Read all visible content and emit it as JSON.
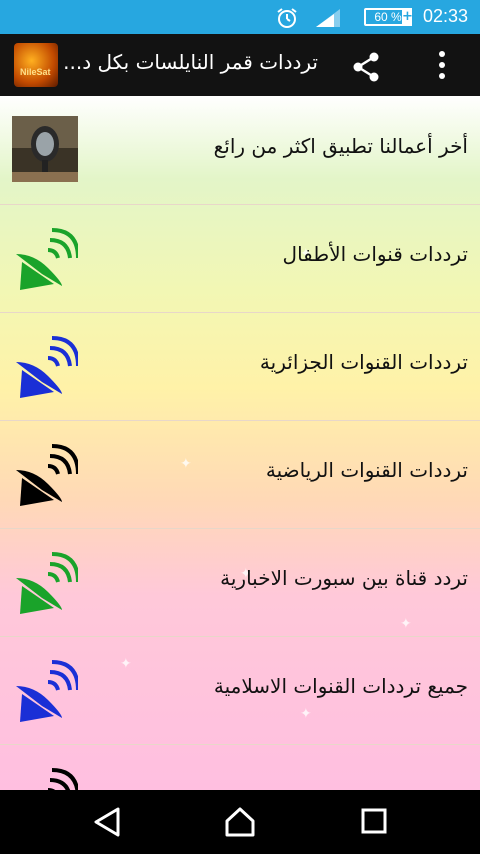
{
  "status_bar": {
    "time": "02:33",
    "battery_percent": "60 %",
    "battery_charging": "+",
    "icons": [
      "alarm-icon",
      "signal-icon",
      "battery-icon"
    ]
  },
  "app_bar": {
    "title": "ترددات قمر النايلسات بكل د...",
    "logo_text": "NileSat",
    "actions": [
      "share-icon",
      "overflow-menu-icon"
    ]
  },
  "list": {
    "items": [
      {
        "label": "أخر أعمالنا تطبيق اكثر من رائع",
        "icon": "antenna-photo",
        "color": "#555555"
      },
      {
        "label": "ترددات قنوات الأطفال",
        "icon": "satellite-dish-icon",
        "color": "#1aa32a"
      },
      {
        "label": "ترددات القنوات الجزائرية",
        "icon": "satellite-dish-icon",
        "color": "#1a2fd6"
      },
      {
        "label": "ترددات القنوات الرياضية",
        "icon": "satellite-dish-icon",
        "color": "#000000"
      },
      {
        "label": "تردد قناة بين سبورت الاخبارية",
        "icon": "satellite-dish-icon",
        "color": "#1aa32a"
      },
      {
        "label": "جميع ترددات القنوات الاسلامية",
        "icon": "satellite-dish-icon",
        "color": "#1a2fd6"
      },
      {
        "label": "",
        "icon": "satellite-dish-icon",
        "color": "#000000"
      }
    ]
  },
  "nav_bar": {
    "buttons": [
      "back-icon",
      "home-icon",
      "recents-icon"
    ]
  }
}
